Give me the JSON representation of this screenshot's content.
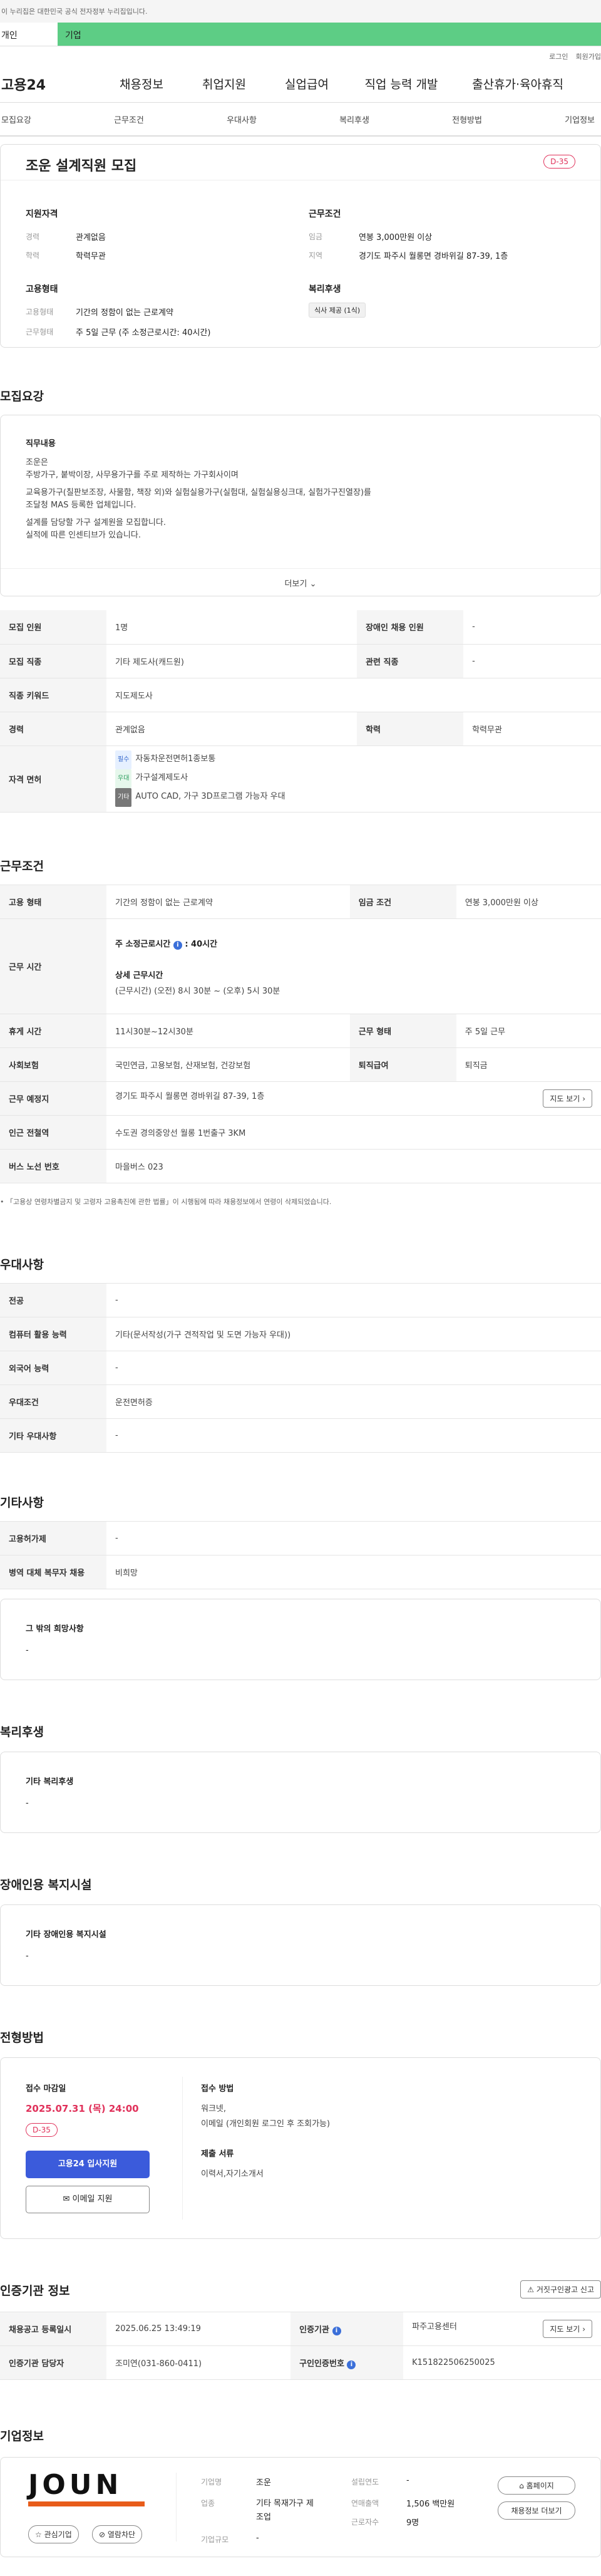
{
  "banner": {
    "text": "이 누리집은 대한민국 공식 전자정부 누리집입니다."
  },
  "user_tabs": {
    "personal": "개인",
    "company": "기업"
  },
  "util": {
    "login": "로그인",
    "join": "회원가입"
  },
  "gnb": {
    "logo": "고용24",
    "items": [
      "채용정보",
      "취업지원",
      "실업급여",
      "직업 능력 개발",
      "출산휴가·육아휴직"
    ]
  },
  "subnav": [
    "모집요강",
    "근무조건",
    "우대사항",
    "복리후생",
    "전형방법",
    "기업정보"
  ],
  "summary": {
    "title": "조운 설계직원 모집",
    "dday": "D-35",
    "qual_h": "지원자격",
    "career_l": "경력",
    "career_v": "관계없음",
    "edu_l": "학력",
    "edu_v": "학력무관",
    "cond_h": "근무조건",
    "pay_l": "임금",
    "pay_v": "연봉 3,000만원 이상",
    "region_l": "지역",
    "region_v": "경기도 파주시 월롱면 경바위길 87-39, 1층",
    "emp_h": "고용형태",
    "emptype_l": "고용형태",
    "emptype_v": "기간의 정함이 없는 근로계약",
    "worktype_l": "근무형태",
    "worktype_v": "주 5일 근무 (주 소정근로시간: 40시간)",
    "welfare_h": "복리후생",
    "welfare_tag": "식사 제공 (1식)"
  },
  "recruit": {
    "heading": "모집요강",
    "job_h": "직무내용",
    "job_lines": [
      "조운은",
      "주방가구, 붙박이장, 사무용가구를 주로 제작하는 가구회사이며",
      "교육용가구(칠판보조장, 사물함, 책장 외)와 실험실용가구(실험대, 실험실용싱크대, 실험가구진열장)를",
      "조달청 MAS 등록한 업체입니다.",
      "설계를 담당할  가구 설계원을 모집합니다.",
      "실적에 따른 인센티브가 있습니다."
    ],
    "more": "더보기",
    "headcount_l": "모집 인원",
    "headcount_v": "1명",
    "disabled_l": "장애인 채용 인원",
    "disabled_v": "-",
    "occupation_l": "모집 직종",
    "occupation_v": "기타 제도사(캐드원)",
    "related_l": "관련 직종",
    "related_v": "-",
    "keyword_l": "직종 키워드",
    "keyword_v": "지도제도사",
    "career_l": "경력",
    "career_v": "관계없음",
    "edu_l": "학력",
    "edu_v": "학력무관",
    "license_l": "자격 면허",
    "licenses": [
      {
        "tag": "필수",
        "text": "자동차운전면허1종보통"
      },
      {
        "tag": "우대",
        "text": "가구설계제도사"
      },
      {
        "tag": "기타",
        "text": "AUTO CAD, 가구 3D프로그램 가능자 우대"
      }
    ]
  },
  "conditions": {
    "heading": "근무조건",
    "emp_l": "고용 형태",
    "emp_v": "기간의 정함이 없는 근로계약",
    "pay_l": "임금 조건",
    "pay_v": "연봉 3,000만원 이상",
    "hours_l": "근무 시간",
    "weekly": "주 소정근로시간",
    "weekly_v": ": 40시간",
    "detail_h": "상세 근무시간",
    "detail_v": "(근무시간) (오전) 8시 30분 ~ (오후) 5시 30분",
    "rest_l": "휴게 시간",
    "rest_v": "11시30분~12시30분",
    "form_l": "근무 형태",
    "form_v": "주 5일 근무",
    "ins_l": "사회보험",
    "ins_v": "국민연금, 고용보험, 산재보험, 건강보험",
    "retire_l": "퇴직급여",
    "retire_v": "퇴직금",
    "place_l": "근무 예정지",
    "place_v": "경기도 파주시 월롱면 경바위길 87-39, 1층",
    "map_btn": "지도 보기",
    "subway_l": "인근 전철역",
    "subway_v": "수도권 경의중앙선 월롱 1번출구 3KM",
    "bus_l": "버스 노선 번호",
    "bus_v": "마을버스 023",
    "note": "「고용상 연령차별금지 및 고령자 고용촉진에 관한 법률」이 시행됨에 따라 채용정보에서 연령이 삭제되었습니다."
  },
  "pref": {
    "heading": "우대사항",
    "major_l": "전공",
    "major_v": "-",
    "pc_l": "컴퓨터 활용 능력",
    "pc_v": "기타(문서작성(가구 견적작업 및 도면 가능자 우대))",
    "lang_l": "외국어 능력",
    "lang_v": "-",
    "cond_l": "우대조건",
    "cond_v": "운전면허증",
    "etc_l": "기타 우대사항",
    "etc_v": "-"
  },
  "others": {
    "heading": "기타사항",
    "subsidy_l": "고용허가제",
    "subsidy_v": "-",
    "military_l": "병역 대체 복무자 채용",
    "military_v": "비희망",
    "wish_h": "그 밖의 희망사항",
    "wish_v": "-"
  },
  "welfare": {
    "heading": "복리후생",
    "h": "기타 복리후생",
    "v": "-"
  },
  "facility": {
    "heading": "장애인용 복지시설",
    "h": "기타 장애인용 복지시설",
    "v": "-"
  },
  "screening": {
    "heading": "전형방법",
    "deadline_h": "접수 마감일",
    "deadline_v": "2025.07.31 (목) 24:00",
    "dday": "D-35",
    "apply_btn": "고용24 입사지원",
    "email_btn": "이메일 지원",
    "method_h": "접수 방법",
    "method_v1": "워크넷,",
    "method_v2": "이메일 (개인회원 로그인 후 조회가능)",
    "docs_h": "제출 서류",
    "docs_v": "이력서,자기소개서"
  },
  "cert": {
    "heading": "인증기관 정보",
    "report_btn": "거짓구인광고 신고",
    "reg_l": "채용공고 등록일시",
    "reg_v": "2025.06.25 13:49:19",
    "agency_l": "인증기관",
    "agency_v": "파주고용센터",
    "map_btn": "지도 보기",
    "manager_l": "인증기관 담당자",
    "manager_v": "조미연(031-860-0411)",
    "no_l": "구인인증번호",
    "no_v": "K151822506250025"
  },
  "company": {
    "heading": "기업정보",
    "logo": "JOUN",
    "fav": "관심기업",
    "block": "열람차단",
    "name_l": "기업명",
    "name_v": "조운",
    "industry_l": "업종",
    "industry_v1": "기타 목재가구 제",
    "industry_v2": "조업",
    "size_l": "기업규모",
    "size_v": "-",
    "founded_l": "설립연도",
    "founded_v": "-",
    "sales_l": "연매출액",
    "sales_v": "1,506 백만원",
    "staff_l": "근로자수",
    "staff_v": "9명",
    "home_btn": "홈페이지",
    "more_btn": "채용정보 더보기"
  }
}
